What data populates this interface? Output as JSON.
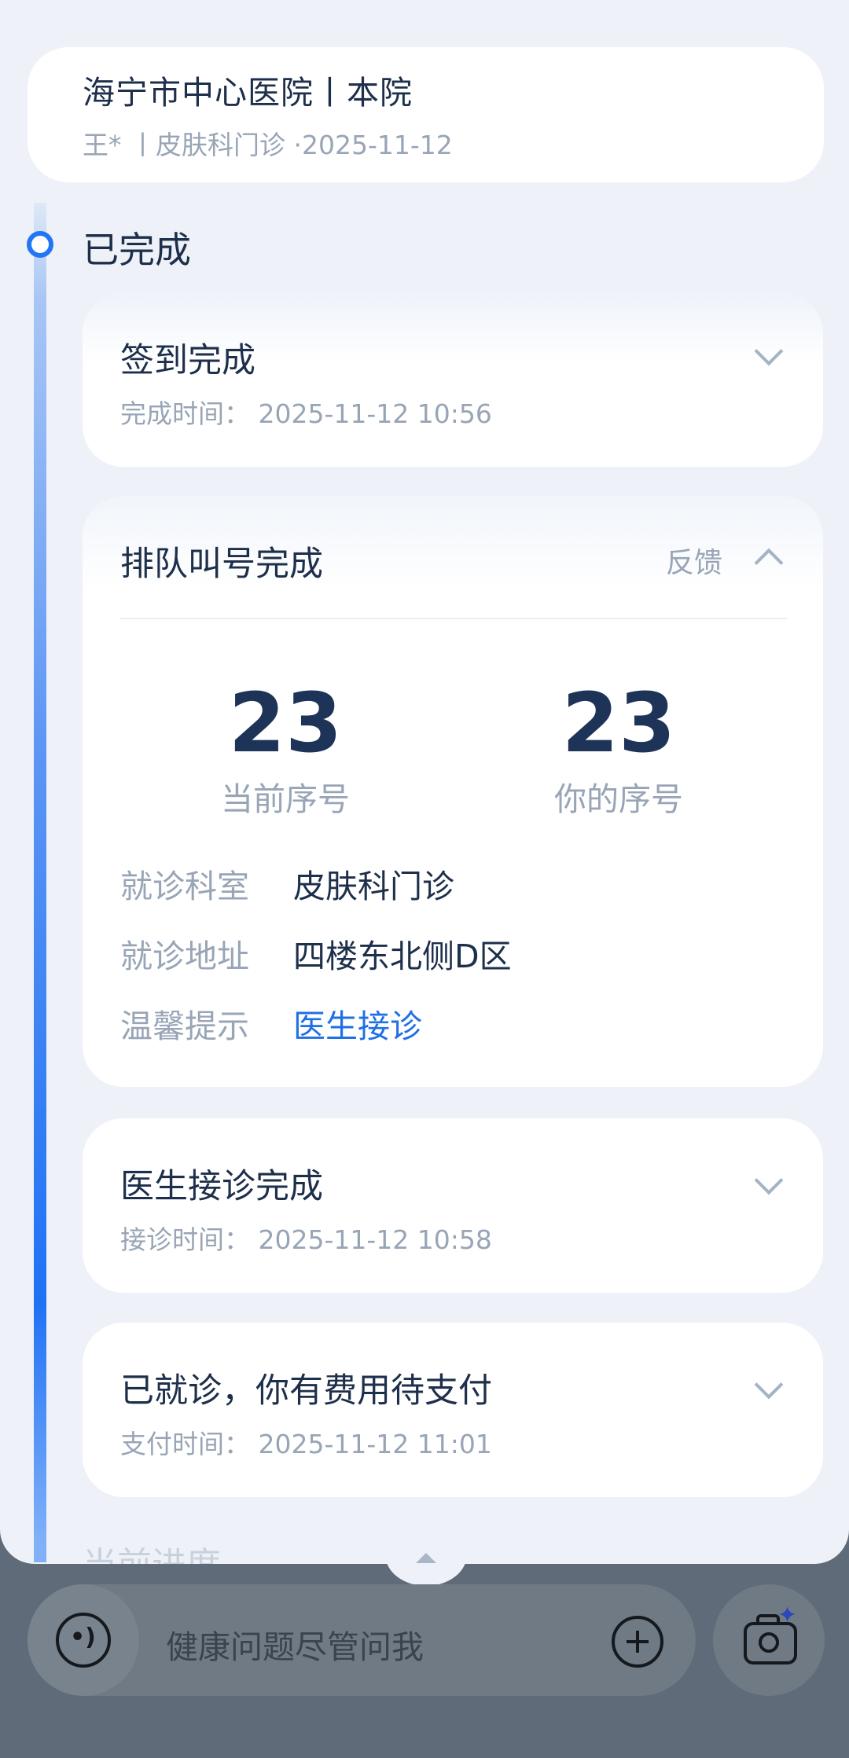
{
  "header": {
    "hospital": "海宁市中心医院丨本院",
    "subline": "王*  丨皮肤科门诊 ·2025-11-12"
  },
  "timeline": {
    "section_title": "已完成",
    "next_section_faded": "当前进度"
  },
  "steps": {
    "checkin": {
      "title": "签到完成",
      "time": "完成时间：  2025-11-12 10:56"
    },
    "queue": {
      "title": "排队叫号完成",
      "feedback": "反馈",
      "current_number": "23",
      "current_label": "当前序号",
      "your_number": "23",
      "your_label": "你的序号",
      "info": [
        {
          "label": "就诊科室",
          "value": "皮肤科门诊"
        },
        {
          "label": "就诊地址",
          "value": "四楼东北侧D区"
        },
        {
          "label": "温馨提示",
          "value": "医生接诊"
        }
      ]
    },
    "doctor": {
      "title": "医生接诊完成",
      "time": "接诊时间：  2025-11-12 10:58"
    },
    "payment": {
      "title": "已就诊，你有费用待支付",
      "time": "支付时间：  2025-11-12 11:01"
    }
  },
  "bottom_bar": {
    "placeholder": "健康问题尽管问我"
  },
  "colors": {
    "accent": "#2275f5",
    "link": "#1f6fe5",
    "text_primary": "#1d2f4a",
    "text_secondary": "#98a5b6"
  }
}
